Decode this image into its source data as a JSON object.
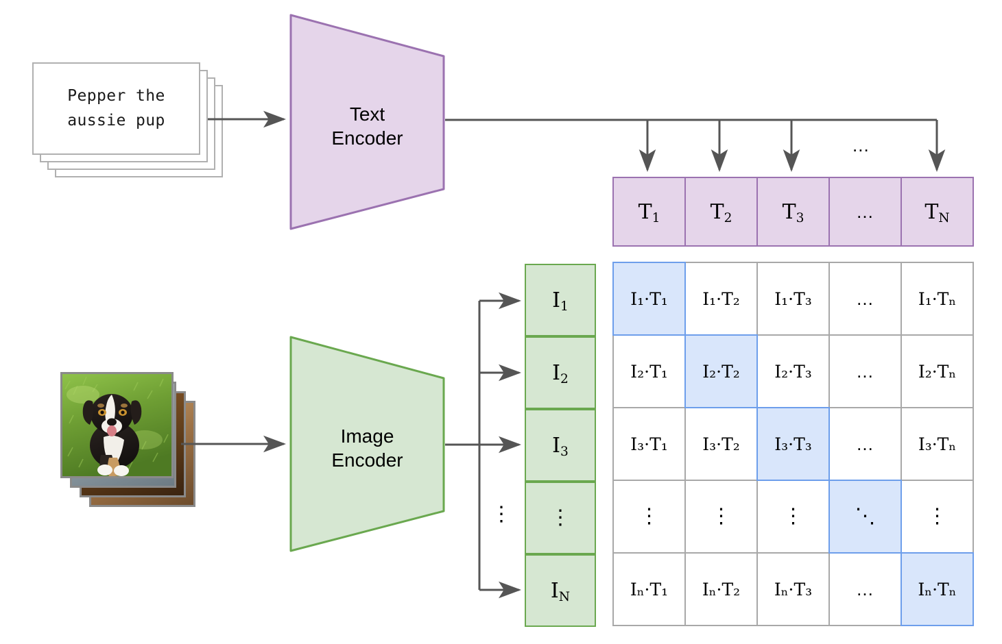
{
  "figure": {
    "title": "CLIP contrastive pre-training diagram",
    "colors": {
      "text_purple_fill": "#e5d5ea",
      "text_purple_border": "#9b72b0",
      "image_green_fill": "#d6e7d2",
      "image_green_border": "#6aa84f",
      "diagonal_blue_fill": "#d9e6fb",
      "diagonal_blue_border": "#6d9eeb",
      "grid_gray_border": "#a8a8a8",
      "arrow_gray": "#555555",
      "card_border": "#b0b0b0"
    }
  },
  "text_input": {
    "caption_line1": "Pepper the",
    "caption_line2": "aussie pup",
    "caption_full": "Pepper the aussie pup",
    "stack_count": 4
  },
  "image_input": {
    "stack_count": 4,
    "photos": [
      {
        "name": "aussie-puppy-on-grass",
        "alt": "tricolor australian shepherd puppy sitting on green grass"
      },
      {
        "name": "sink-photo",
        "alt": "blurred sink photo"
      },
      {
        "name": "wood-table-photo",
        "alt": "blurred wooden surface photo"
      },
      {
        "name": "cat-photo",
        "alt": "blurred tan cat photo"
      }
    ]
  },
  "encoders": {
    "text": {
      "label": "Text\nEncoder",
      "line1": "Text",
      "line2": "Encoder"
    },
    "image": {
      "label": "Image\nEncoder",
      "line1": "Image",
      "line2": "Encoder"
    }
  },
  "text_embeddings": {
    "label_prefix": "T",
    "cells": [
      {
        "base": "T",
        "sub": "1",
        "ellipsis": false
      },
      {
        "base": "T",
        "sub": "2",
        "ellipsis": false
      },
      {
        "base": "T",
        "sub": "3",
        "ellipsis": false
      },
      {
        "base": "",
        "sub": "",
        "ellipsis": true,
        "text": "..."
      },
      {
        "base": "T",
        "sub": "N",
        "ellipsis": false
      }
    ]
  },
  "image_embeddings": {
    "label_prefix": "I",
    "cells": [
      {
        "base": "I",
        "sub": "1",
        "ellipsis": false
      },
      {
        "base": "I",
        "sub": "2",
        "ellipsis": false
      },
      {
        "base": "I",
        "sub": "3",
        "ellipsis": false
      },
      {
        "base": "",
        "sub": "",
        "ellipsis": true,
        "text": "⋮"
      },
      {
        "base": "I",
        "sub": "N",
        "ellipsis": false
      }
    ]
  },
  "ellipses": {
    "text_bus_dots": "...",
    "image_bus_vdots": "⋮"
  },
  "similarity_matrix": {
    "rows": [
      {
        "row_index": "1",
        "cells": [
          {
            "text": "I₁·T₁",
            "i": "1",
            "t": "1",
            "kind": "product",
            "highlighted": true
          },
          {
            "text": "I₁·T₂",
            "i": "1",
            "t": "2",
            "kind": "product",
            "highlighted": false
          },
          {
            "text": "I₁·T₃",
            "i": "1",
            "t": "3",
            "kind": "product",
            "highlighted": false
          },
          {
            "text": "...",
            "kind": "hdots",
            "highlighted": false
          },
          {
            "text": "I₁·Tₙ",
            "i": "1",
            "t": "N",
            "kind": "product",
            "highlighted": false
          }
        ]
      },
      {
        "row_index": "2",
        "cells": [
          {
            "text": "I₂·T₁",
            "i": "2",
            "t": "1",
            "kind": "product",
            "highlighted": false
          },
          {
            "text": "I₂·T₂",
            "i": "2",
            "t": "2",
            "kind": "product",
            "highlighted": true
          },
          {
            "text": "I₂·T₃",
            "i": "2",
            "t": "3",
            "kind": "product",
            "highlighted": false
          },
          {
            "text": "...",
            "kind": "hdots",
            "highlighted": false
          },
          {
            "text": "I₂·Tₙ",
            "i": "2",
            "t": "N",
            "kind": "product",
            "highlighted": false
          }
        ]
      },
      {
        "row_index": "3",
        "cells": [
          {
            "text": "I₃·T₁",
            "i": "3",
            "t": "1",
            "kind": "product",
            "highlighted": false
          },
          {
            "text": "I₃·T₂",
            "i": "3",
            "t": "2",
            "kind": "product",
            "highlighted": false
          },
          {
            "text": "I₃·T₃",
            "i": "3",
            "t": "3",
            "kind": "product",
            "highlighted": true
          },
          {
            "text": "...",
            "kind": "hdots",
            "highlighted": false
          },
          {
            "text": "I₃·Tₙ",
            "i": "3",
            "t": "N",
            "kind": "product",
            "highlighted": false
          }
        ]
      },
      {
        "row_index": "dots",
        "cells": [
          {
            "text": "⋮",
            "kind": "vdots",
            "highlighted": false
          },
          {
            "text": "⋮",
            "kind": "vdots",
            "highlighted": false
          },
          {
            "text": "⋮",
            "kind": "vdots",
            "highlighted": false
          },
          {
            "text": "⋱",
            "kind": "ddots",
            "highlighted": true
          },
          {
            "text": "⋮",
            "kind": "vdots",
            "highlighted": false
          }
        ]
      },
      {
        "row_index": "N",
        "cells": [
          {
            "text": "Iₙ·T₁",
            "i": "N",
            "t": "1",
            "kind": "product",
            "highlighted": false
          },
          {
            "text": "Iₙ·T₂",
            "i": "N",
            "t": "2",
            "kind": "product",
            "highlighted": false
          },
          {
            "text": "Iₙ·T₃",
            "i": "N",
            "t": "3",
            "kind": "product",
            "highlighted": false
          },
          {
            "text": "...",
            "kind": "hdots",
            "highlighted": false
          },
          {
            "text": "Iₙ·Tₙ",
            "i": "N",
            "t": "N",
            "kind": "product",
            "highlighted": true
          }
        ]
      }
    ]
  }
}
